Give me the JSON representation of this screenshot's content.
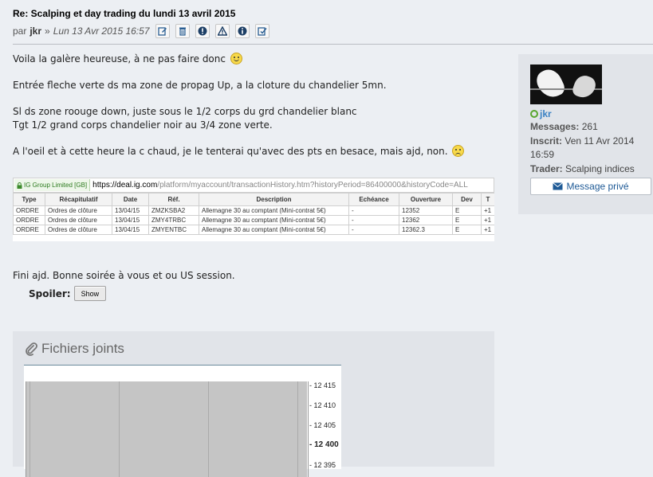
{
  "post": {
    "title": "Re: Scalping et day trading du lundi 13 avril 2015",
    "by_prefix": "par",
    "author": "jkr",
    "separator": "»",
    "date": "Lun 13 Avr 2015 16:57"
  },
  "post_actions": [
    {
      "name": "edit-icon"
    },
    {
      "name": "trash-icon"
    },
    {
      "name": "info-warning-icon"
    },
    {
      "name": "alert-triangle-icon"
    },
    {
      "name": "info-icon"
    },
    {
      "name": "quote-icon"
    }
  ],
  "content": {
    "p1": "Voila la galère heureuse, à ne pas faire donc",
    "p2": "Entrée fleche verte ds ma zone de propag Up, a la cloture du chandelier 5mn.",
    "p3a": "Sl ds zone roouge down, juste sous le 1/2 corps du grd chandelier blanc",
    "p3b": "Tgt 1/2 grand corps chandelier noir au 3/4 zone verte.",
    "p4": "A l'oeil et à cette heure la c chaud, je le tenterai qu'avec des pts en besace, mais ajd, non.",
    "p5": "Fini ajd. Bonne soirée à vous et ou US session."
  },
  "screenshot": {
    "ssl_label": "IG Group Limited [GB]",
    "url_host": "https://deal.ig.com",
    "url_rest": "/platform/myaccount/transactionHistory.htm?historyPeriod=86400000&historyCode=ALL",
    "columns": [
      "Type",
      "Récapitulatif",
      "Date",
      "Réf.",
      "Description",
      "Echéance",
      "Ouverture",
      "Dev",
      "T"
    ],
    "rows": [
      [
        "ORDRE",
        "Ordres de clôture",
        "13/04/15",
        "ZMZKSBA2",
        "Allemagne 30 au comptant (Mini-contrat 5€)",
        "-",
        "12352",
        "E",
        "+1"
      ],
      [
        "ORDRE",
        "Ordres de clôture",
        "13/04/15",
        "ZMY4TRBC",
        "Allemagne 30 au comptant (Mini-contrat 5€)",
        "-",
        "12362",
        "E",
        "+1"
      ],
      [
        "ORDRE",
        "Ordres de clôture",
        "13/04/15",
        "ZMYENTBC",
        "Allemagne 30 au comptant (Mini-contrat 5€)",
        "-",
        "12362.3",
        "E",
        "+1"
      ]
    ]
  },
  "spoiler": {
    "label": "Spoiler:",
    "button": "Show"
  },
  "attachments": {
    "title": "Fichiers joints",
    "y_labels": [
      "12 415",
      "12 410",
      "12 405",
      "12 400",
      "12 395"
    ]
  },
  "sidebar": {
    "username": "jkr",
    "messages_label": "Messages:",
    "messages_value": "261",
    "joined_label": "Inscrit:",
    "joined_value": "Ven 11 Avr 2014 16:59",
    "trader_label": "Trader:",
    "trader_value": "Scalping indices",
    "pm_button": "Message privé"
  }
}
